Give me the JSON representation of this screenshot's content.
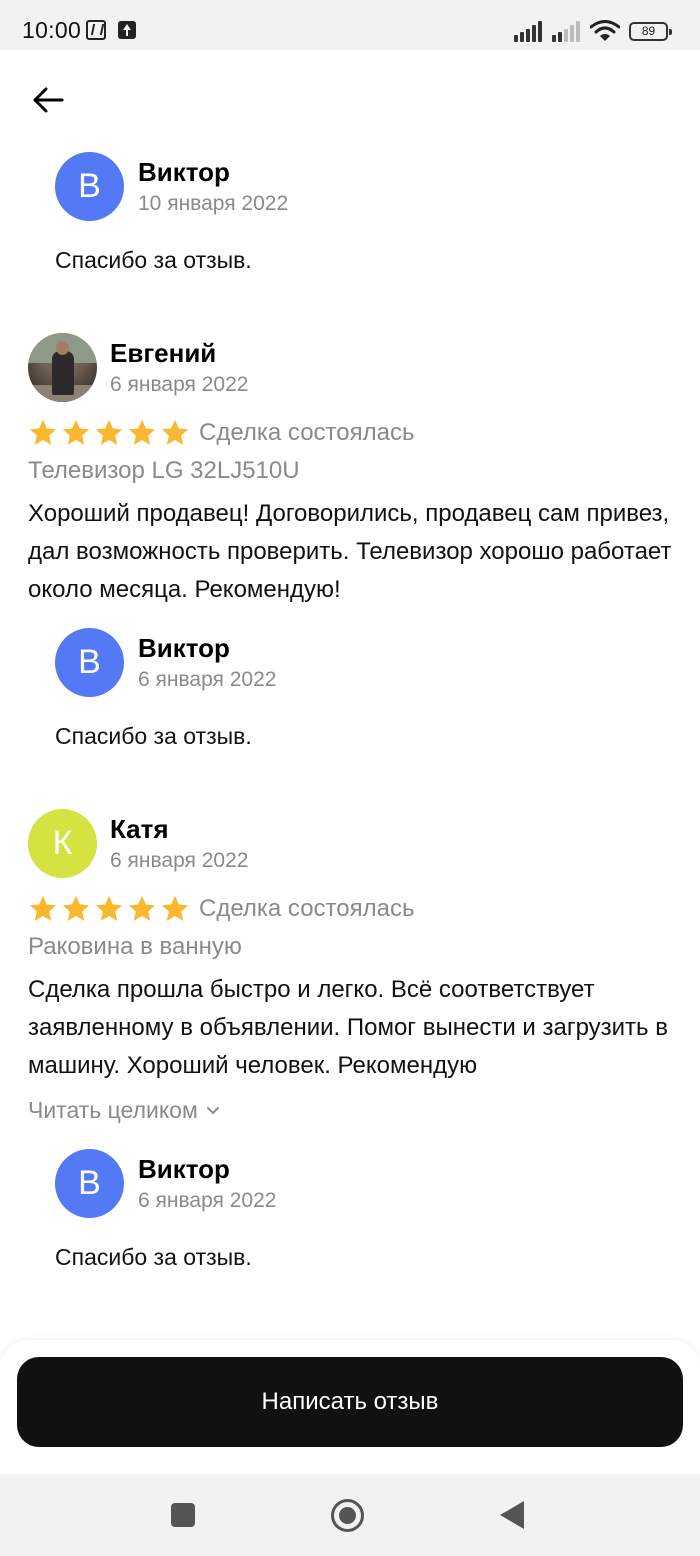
{
  "status_bar": {
    "time": "10:00",
    "battery": "89",
    "icons": [
      "nfc-icon",
      "upload-icon",
      "signal-icon",
      "signal-icon",
      "wifi-icon",
      "battery-icon"
    ]
  },
  "header": {
    "back_icon": "arrow-left-icon"
  },
  "reviews": [
    {
      "reply": {
        "avatar_letter": "В",
        "name": "Виктор",
        "date": "10 января 2022",
        "text": "Спасибо за отзыв."
      }
    },
    {
      "author": "Евгений",
      "date": "6 января 2022",
      "rating": 5,
      "status": "Сделка состоялась",
      "item": "Телевизор LG 32LJ510U",
      "text": "Хороший продавец! Договорились, продавец сам привез, дал возможность проверить. Телевизор хорошо работает около месяца. Рекомендую!",
      "reply": {
        "avatar_letter": "В",
        "name": "Виктор",
        "date": "6 января 2022",
        "text": "Спасибо за отзыв."
      }
    },
    {
      "author": "Катя",
      "avatar_letter": "К",
      "date": "6 января 2022",
      "rating": 5,
      "status": "Сделка состоялась",
      "item": "Раковина в ванную",
      "text": "Сделка прошла быстро и легко. Всё соответствует заявленному в объявлении. Помог вынести и загрузить в машину. Хороший человек. Рекомендую",
      "read_more": "Читать целиком",
      "reply": {
        "avatar_letter": "В",
        "name": "Виктор",
        "date": "6 января 2022",
        "text": "Спасибо за отзыв."
      }
    }
  ],
  "footer": {
    "write_review_label": "Написать отзыв"
  },
  "colors": {
    "avatar_blue": "#5379f5",
    "avatar_lime": "#d4e342",
    "star": "#f9b82f",
    "button": "#111111",
    "muted_text": "#8a8a8a"
  }
}
